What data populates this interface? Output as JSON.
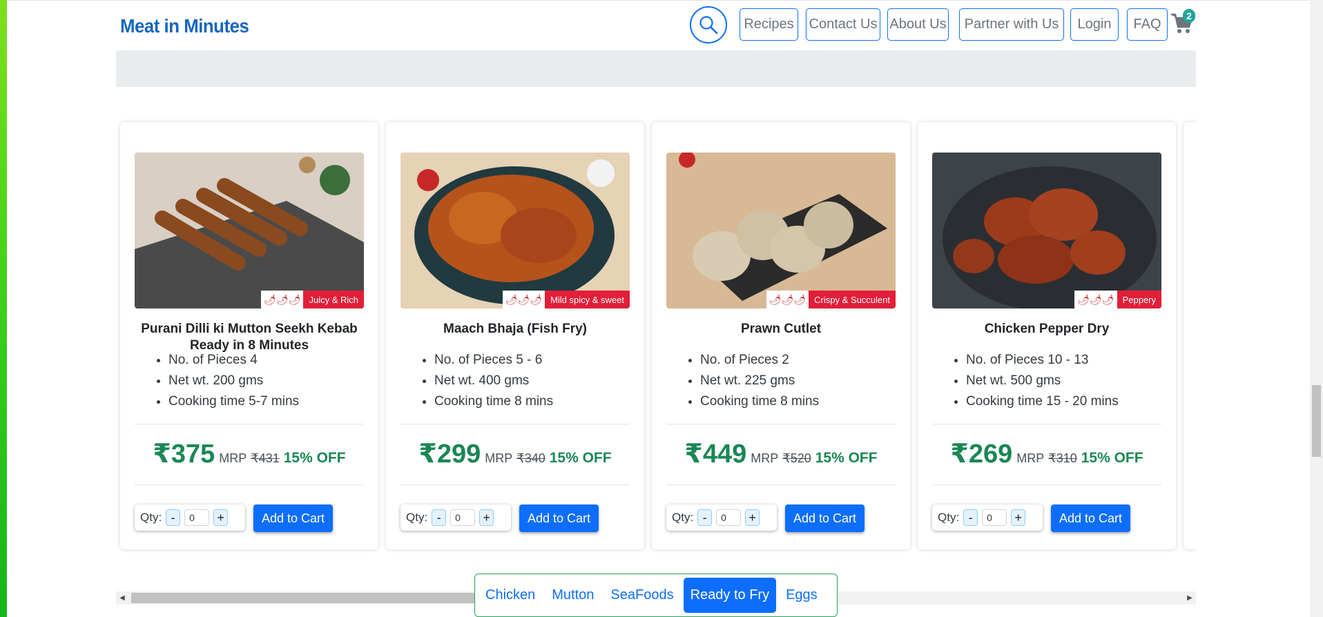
{
  "header": {
    "logo_text": "Meat in Minutes",
    "nav": [
      "Recipes",
      "Contact Us",
      "About Us",
      "Partner with Us",
      "Login",
      "FAQ"
    ],
    "cart_count": "2"
  },
  "products": [
    {
      "title": "Purani Dilli ki Mutton Seekh Kebab Ready in 8 Minutes",
      "tag": "Juicy & Rich",
      "features": [
        "No. of Pieces 4",
        "Net wt. 200 gms",
        "Cooking time 5-7 mins"
      ],
      "price": "₹375",
      "mrp_label": "MRP",
      "mrp": "₹431",
      "discount": "15% OFF",
      "qty_label": "Qty:",
      "qty_value": "0",
      "add_label": "Add to Cart"
    },
    {
      "title": "Maach Bhaja (Fish Fry)",
      "tag": "Mild spicy & sweet",
      "features": [
        "No. of Pieces 5 - 6",
        "Net wt. 400 gms",
        "Cooking time 8 mins"
      ],
      "price": "₹299",
      "mrp_label": "MRP",
      "mrp": "₹340",
      "discount": "15% OFF",
      "qty_label": "Qty:",
      "qty_value": "0",
      "add_label": "Add to Cart"
    },
    {
      "title": "Prawn Cutlet",
      "tag": "Crispy & Succulent",
      "features": [
        "No. of Pieces 2",
        "Net wt. 225 gms",
        "Cooking time 8 mins"
      ],
      "price": "₹449",
      "mrp_label": "MRP",
      "mrp": "₹520",
      "discount": "15% OFF",
      "qty_label": "Qty:",
      "qty_value": "0",
      "add_label": "Add to Cart"
    },
    {
      "title": "Chicken Pepper Dry",
      "tag": "Peppery",
      "features": [
        "No. of Pieces 10 - 13",
        "Net wt. 500 gms",
        "Cooking time 15 - 20 mins"
      ],
      "price": "₹269",
      "mrp_label": "MRP",
      "mrp": "₹310",
      "discount": "15% OFF",
      "qty_label": "Qty:",
      "qty_value": "0",
      "add_label": "Add to Cart"
    }
  ],
  "qty_controls": {
    "minus": "-",
    "plus": "+"
  },
  "category_nav": {
    "items": [
      "Chicken",
      "Mutton",
      "SeaFoods",
      "Ready to Fry",
      "Eggs"
    ],
    "active": "Ready to Fry"
  },
  "colors": {
    "primary": "#0d6efd",
    "price_green": "#198754",
    "tag_red": "#e31e39",
    "logo_blue": "#1565c0"
  },
  "icons": {
    "search": "search-icon",
    "cart": "cart-icon",
    "chili": "chili-icon"
  }
}
